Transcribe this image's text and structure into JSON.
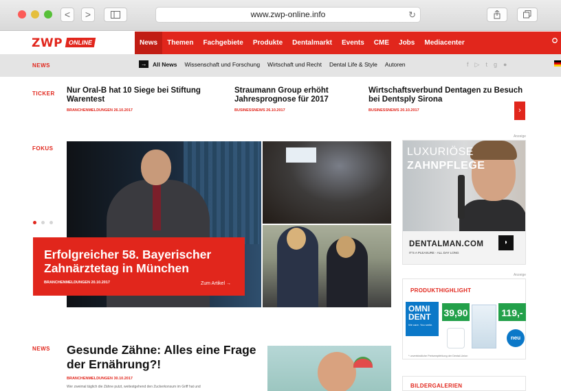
{
  "browser": {
    "url": "www.zwp-online.info",
    "back_icon": "<",
    "forward_icon": ">"
  },
  "site": {
    "logo_main": "ZWP",
    "logo_sub": "ONLINE"
  },
  "nav": {
    "items": [
      "News",
      "Themen",
      "Fachgebiete",
      "Produkte",
      "Dentalmarkt",
      "Events",
      "CME",
      "Jobs",
      "Mediacenter"
    ],
    "active": "News"
  },
  "subnav": {
    "section": "NEWS",
    "items": [
      "All News",
      "Wissenschaft und Forschung",
      "Wirtschaft und Recht",
      "Dental Life & Style",
      "Autoren"
    ]
  },
  "ticker": {
    "label": "TICKER",
    "items": [
      {
        "title": "Nur Oral-B hat 10 Siege bei Stiftung Warentest",
        "meta": "BRANCHENMELDUNGEN 26.10.2017"
      },
      {
        "title": "Straumann Group erhöht Jahresprognose für 2017",
        "meta": "BUSINESSNEWS 26.10.2017"
      },
      {
        "title": "Wirtschaftsverbund Dentagen zu Besuch bei Dentsply Sirona",
        "meta": "BUSINESSNEWS 20.10.2017"
      }
    ]
  },
  "fokus": {
    "label": "FOKUS",
    "title": "Erfolgreicher 58. Bayerischer Zahnärztetag in München",
    "meta": "BRANCHENMELDUNGEN 20.10.2017",
    "more": "Zum Artikel"
  },
  "ads": {
    "anzeige": "Anzeige",
    "ad1_line1": "LUXURIÖSE",
    "ad1_line2": "ZAHNPFLEGE",
    "ad1_brand": "DENTALMAN.COM",
    "ad1_tag": "IT'S A PLEASURE - ALL DAY LONG",
    "ad2_title": "PRODUKTHIGHLIGHT",
    "ad2_brand": "OMNI DENT",
    "ad2_slogan": "We care. You smile.",
    "ad2_price1": "39,90",
    "ad2_price2": "119,-",
    "ad2_badge": "neu",
    "ad2_fine": "* unverbindliche Preisempfehlung der Dental-Union"
  },
  "news": {
    "label": "NEWS",
    "title": "Gesunde Zähne: Alles eine Frage der Ernährung?!",
    "meta": "BRANCHENMELDUNGEN 30.10.2017",
    "text": "Wer zweimal täglich die Zähne putzt, weitestgehend den Zuckerkonsum im Griff hat und"
  },
  "gallery": {
    "title": "BILDERGALERIEN"
  }
}
